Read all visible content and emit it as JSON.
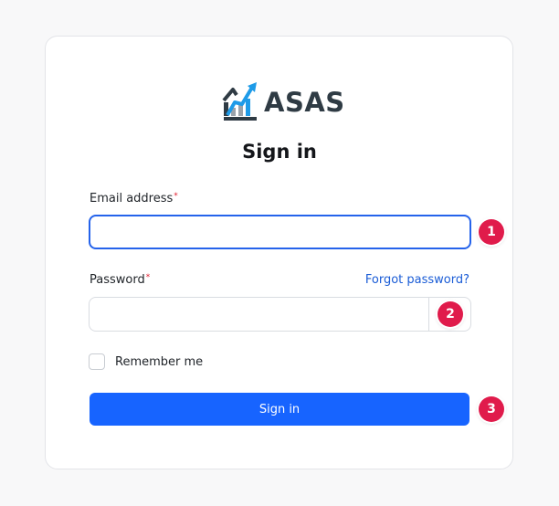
{
  "brand": {
    "name": "ASAS",
    "logo_icon": "rising-chart-logo-icon",
    "colors": {
      "dark": "#2f3b44",
      "light": "#1e9be8"
    }
  },
  "form": {
    "title": "Sign in",
    "email": {
      "label": "Email address",
      "required_mark": "*",
      "value": "",
      "placeholder": ""
    },
    "password": {
      "label": "Password",
      "required_mark": "*",
      "value": "",
      "placeholder": "",
      "forgot_link": "Forgot password?"
    },
    "remember": {
      "label": "Remember me",
      "checked": false
    },
    "submit_label": "Sign in"
  },
  "markers": [
    "1",
    "2",
    "3"
  ],
  "colors": {
    "accent": "#1764ff",
    "focus_border": "#2563eb",
    "link": "#1a5cd6",
    "marker": "#e01b4b",
    "required": "#e11d2e"
  }
}
